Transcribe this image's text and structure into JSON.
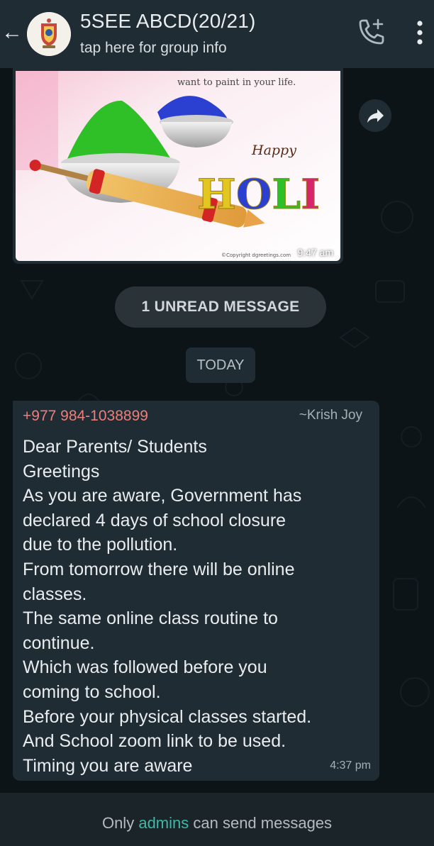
{
  "header": {
    "back_glyph": "←",
    "title": "5SEE ABCD(20/21)",
    "subtitle": "tap here for group info",
    "avatar_icon": "school-crest-icon",
    "call_icon": "add-call-icon",
    "menu_icon": "more-vert-icon"
  },
  "image_message": {
    "image_text": {
      "tagline": "want to paint in your life.",
      "happy": "Happy",
      "holi": "HOLI",
      "copyright": "©Copyright dgreetings.com"
    },
    "time": "9:47 am",
    "share_icon": "share-icon"
  },
  "unread_banner": "1 UNREAD MESSAGE",
  "date_divider": "TODAY",
  "message": {
    "sender_phone": "+977 984-1038899",
    "sender_name": "~Krish Joy",
    "lines": [
      "Dear Parents/ Students",
      "Greetings",
      "As you are aware, Government has",
      "declared 4 days of school closure",
      "due to the pollution.",
      "From tomorrow there will be online",
      "classes.",
      "The same online class routine to",
      "continue.",
      "Which was followed before you",
      "coming to school.",
      "Before your physical classes started.",
      "And School zoom link to be used.",
      "Timing you are aware"
    ],
    "time": "4:37 pm"
  },
  "footer": {
    "prefix": "Only",
    "link": "admins",
    "suffix": "can send messages"
  },
  "colors": {
    "header_bg": "#1f2c34",
    "chat_bg": "#0d1418",
    "bubble_bg": "#1f2c34",
    "sender_phone": "#ef7e7a",
    "admins_link": "#3fb9a5"
  }
}
